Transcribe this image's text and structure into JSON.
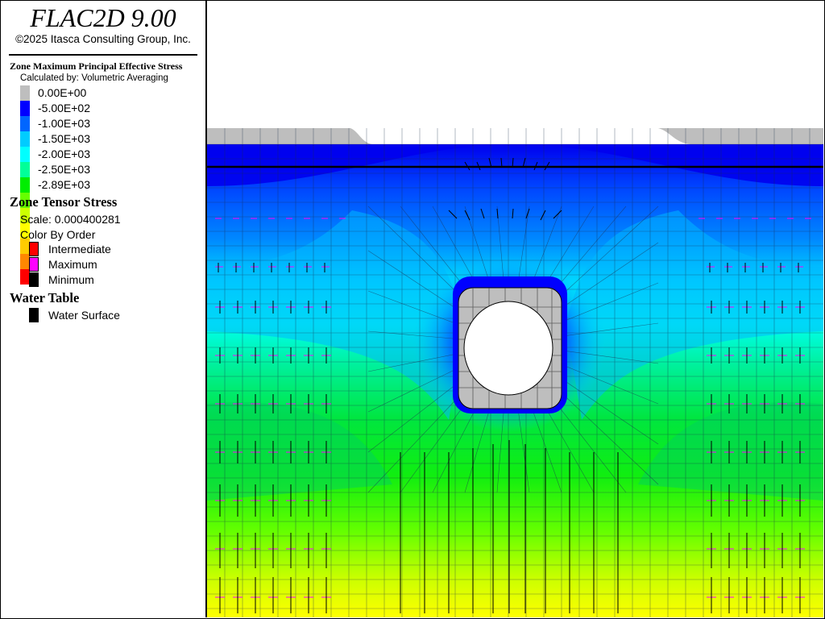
{
  "app": {
    "title": "FLAC2D 9.00",
    "copyright": "©2025 Itasca Consulting Group, Inc."
  },
  "contour": {
    "title": "Zone Maximum Principal Effective Stress",
    "subtitle": "Calculated by: Volumetric Averaging",
    "colors": [
      "#bebebe",
      "#0000ff",
      "#0066ff",
      "#00ccff",
      "#00ffff",
      "#00ff99",
      "#00ee00",
      "#66ff00",
      "#ccff00",
      "#ffff00",
      "#ffcc00",
      "#ff8800",
      "#ff0000"
    ],
    "labels": [
      "0.00E+00",
      "-5.00E+02",
      "-1.00E+03",
      "-1.50E+03",
      "-2.00E+03",
      "-2.50E+03",
      "-2.89E+03"
    ]
  },
  "tensor": {
    "title": "Zone Tensor Stress",
    "scale": "Scale: 0.000400281",
    "color_by": "Color By Order",
    "items": [
      {
        "label": "Intermediate",
        "color": "#ff0000"
      },
      {
        "label": "Maximum",
        "color": "#ff00ff"
      },
      {
        "label": "Minimum",
        "color": "#000000"
      }
    ]
  },
  "water": {
    "title": "Water Table",
    "items": [
      {
        "label": "Water Surface",
        "color": "#000000"
      }
    ]
  }
}
